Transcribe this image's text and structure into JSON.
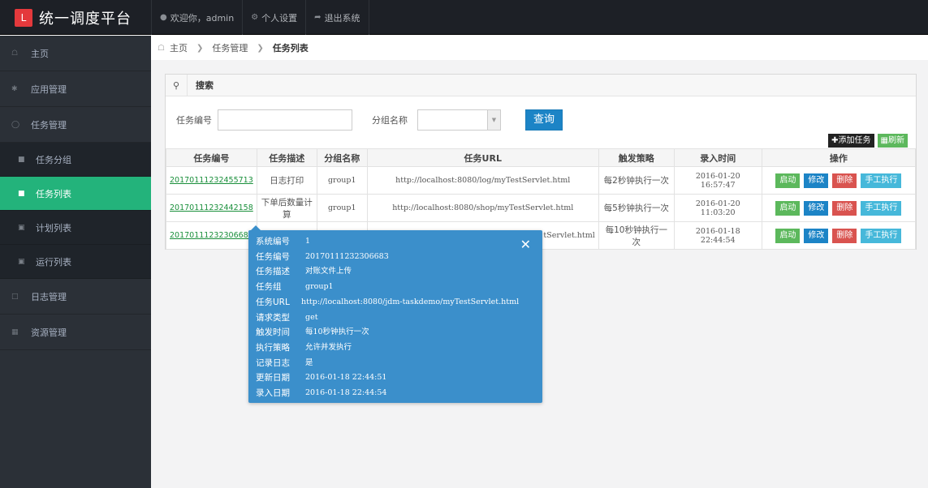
{
  "brand": {
    "logo_glyph": "L",
    "title": "统一调度平台"
  },
  "topnav": {
    "welcome": "欢迎你，admin",
    "settings": "个人设置",
    "logout": "退出系统"
  },
  "sidebar": {
    "items": [
      {
        "label": "主页",
        "icon": "home-icon"
      },
      {
        "label": "应用管理",
        "icon": "gear-icon"
      },
      {
        "label": "任务管理",
        "icon": "clock-icon"
      },
      {
        "label": "任务分组",
        "icon": "truck-icon",
        "sub": true
      },
      {
        "label": "任务列表",
        "icon": "truck-icon",
        "sub": true,
        "active": true
      },
      {
        "label": "计划列表",
        "icon": "tray-icon",
        "sub": true
      },
      {
        "label": "运行列表",
        "icon": "tray-icon",
        "sub": true
      },
      {
        "label": "日志管理",
        "icon": "file-icon"
      },
      {
        "label": "资源管理",
        "icon": "grid-icon"
      }
    ]
  },
  "breadcrumb": {
    "home": "主页",
    "section": "任务管理",
    "current": "任务列表"
  },
  "search": {
    "title": "搜索",
    "task_id_label": "任务编号",
    "task_id_value": "",
    "group_label": "分组名称",
    "group_value": "",
    "query_button": "查询"
  },
  "toolbar": {
    "add": "添加任务",
    "refresh": "刷新"
  },
  "table": {
    "columns": [
      "任务编号",
      "任务描述",
      "分组名称",
      "任务URL",
      "触发策略",
      "录入时间",
      "操作"
    ],
    "rows": [
      {
        "id": "20170111232455713",
        "desc": "日志打印",
        "group": "group1",
        "url": "http://localhost:8080/log/myTestServlet.html",
        "trigger": "每2秒钟执行一次",
        "created": "2016-01-20 16:57:47"
      },
      {
        "id": "20170111232442158",
        "desc": "下单后数量计算",
        "group": "group1",
        "url": "http://localhost:8080/shop/myTestServlet.html",
        "trigger": "每5秒钟执行一次",
        "created": "2016-01-20 11:03:20"
      },
      {
        "id": "20170111232306683",
        "desc": "",
        "group": "",
        "url": "tServlet.html",
        "trigger": "每10秒钟执行一次",
        "created": "2016-01-18 22:44:54"
      }
    ],
    "actions": {
      "start": "启动",
      "edit": "修改",
      "delete": "删除",
      "manual": "手工执行"
    }
  },
  "popover": {
    "close": "✕",
    "rows": [
      {
        "k": "系统编号",
        "v": "1"
      },
      {
        "k": "任务编号",
        "v": "20170111232306683"
      },
      {
        "k": "任务描述",
        "v": "对账文件上传"
      },
      {
        "k": "任务组",
        "v": "group1"
      },
      {
        "k": "任务URL",
        "v": "http://localhost:8080/jdm-taskdemo/myTestServlet.html"
      },
      {
        "k": "请求类型",
        "v": "get"
      },
      {
        "k": "触发时间",
        "v": "每10秒钟执行一次"
      },
      {
        "k": "执行策略",
        "v": "允许并发执行"
      },
      {
        "k": "记录日志",
        "v": "是"
      },
      {
        "k": "更新日期",
        "v": "2016-01-18 22:44:51"
      },
      {
        "k": "录入日期",
        "v": "2016-01-18 22:44:54"
      }
    ]
  },
  "colors": {
    "accent_green": "#23b37b",
    "primary_blue": "#1c84c6",
    "danger_red": "#d9534f",
    "info_cyan": "#46b8da",
    "popover_blue": "#3b8fcb"
  }
}
